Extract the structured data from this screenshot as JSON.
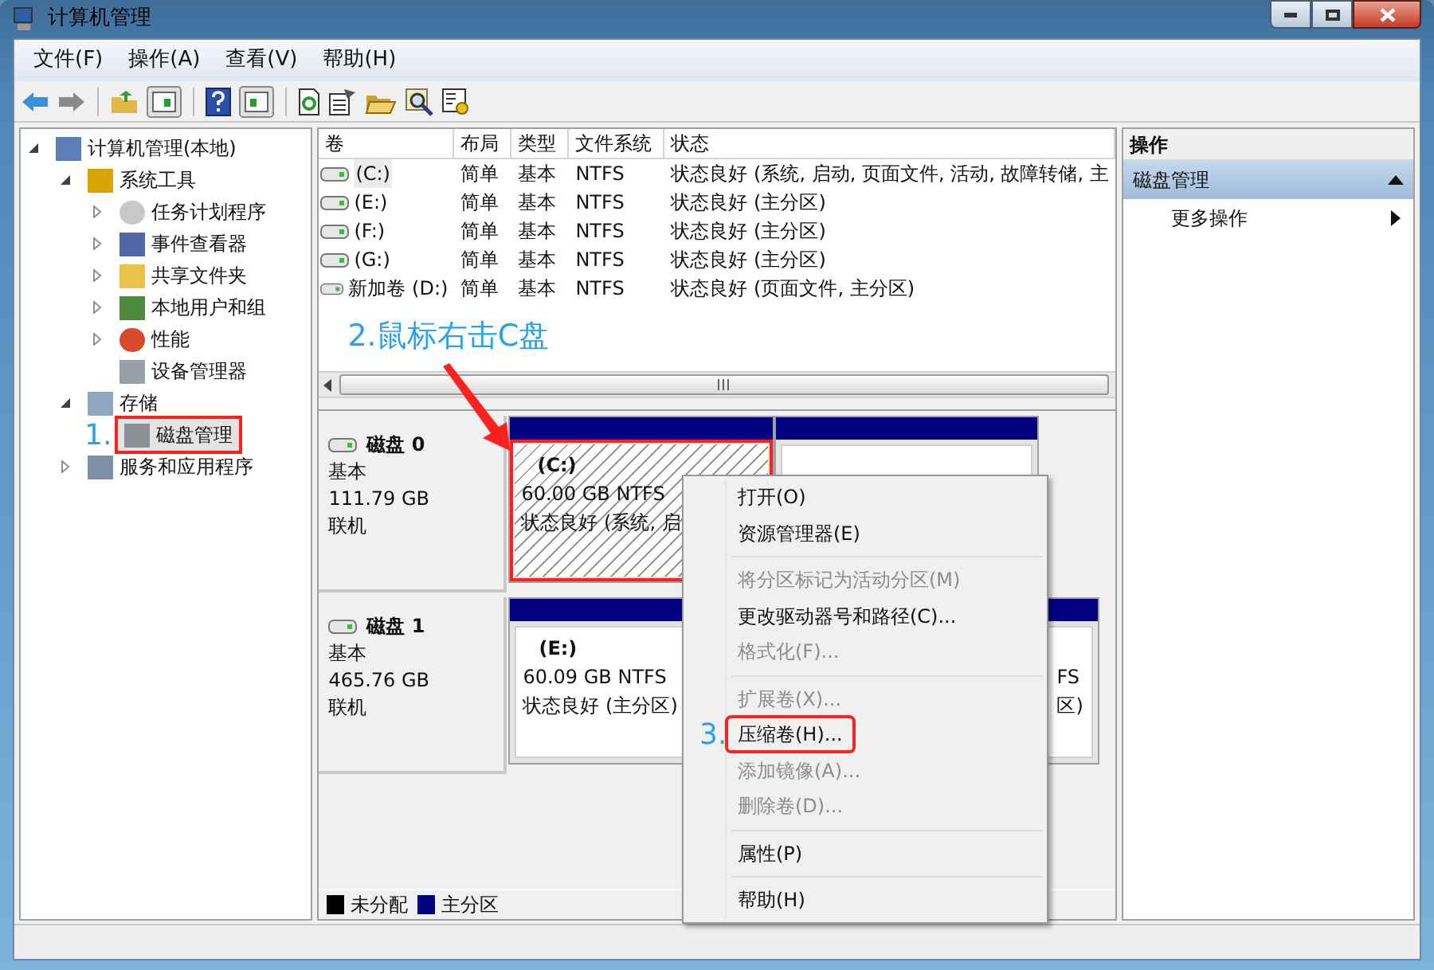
{
  "window": {
    "title": "计算机管理"
  },
  "menu_bar": [
    "文件(F)",
    "操作(A)",
    "查看(V)",
    "帮助(H)"
  ],
  "tree": [
    {
      "label": "计算机管理(本地)",
      "expanded": true,
      "selected": false,
      "children": [
        {
          "label": "系统工具",
          "expanded": true,
          "selected": false,
          "children": [
            {
              "label": "任务计划程序",
              "expanded": false,
              "selected": false
            },
            {
              "label": "事件查看器",
              "expanded": false,
              "selected": false
            },
            {
              "label": "共享文件夹",
              "expanded": false,
              "selected": false
            },
            {
              "label": "本地用户和组",
              "expanded": false,
              "selected": false
            },
            {
              "label": "性能",
              "expanded": false,
              "selected": false
            },
            {
              "label": "设备管理器",
              "selected": false
            }
          ]
        },
        {
          "label": "存储",
          "expanded": true,
          "selected": false,
          "children": [
            {
              "label": "磁盘管理",
              "selected": true,
              "highlighted": true,
              "annotation": "1."
            }
          ]
        },
        {
          "label": "服务和应用程序",
          "expanded": false,
          "selected": false
        }
      ]
    }
  ],
  "volumes": {
    "columns": [
      "卷",
      "布局",
      "类型",
      "文件系统",
      "状态"
    ],
    "rows": [
      [
        "(C:)",
        "简单",
        "基本",
        "NTFS",
        "状态良好 (系统, 启动, 页面文件, 活动, 故障转储, 主"
      ],
      [
        "(E:)",
        "简单",
        "基本",
        "NTFS",
        "状态良好 (主分区)"
      ],
      [
        "(F:)",
        "简单",
        "基本",
        "NTFS",
        "状态良好 (主分区)"
      ],
      [
        "(G:)",
        "简单",
        "基本",
        "NTFS",
        "状态良好 (主分区)"
      ],
      [
        "新加卷 (D:)",
        "简单",
        "基本",
        "NTFS",
        "状态良好 (页面文件, 主分区)"
      ]
    ]
  },
  "callout": {
    "text": "2.鼠标右击C盘"
  },
  "disks": [
    {
      "name": "磁盘 0",
      "type": "基本",
      "size": "111.79 GB",
      "status": "联机",
      "partitions": [
        {
          "kind": "system",
          "label": "(C:)",
          "size": "60.00 GB NTFS",
          "status": "状态良好 (系统, 启",
          "highlighted": true
        },
        {
          "kind": "primary"
        }
      ]
    },
    {
      "name": "磁盘 1",
      "type": "基本",
      "size": "465.76 GB",
      "status": "联机",
      "partitions": [
        {
          "kind": "primary",
          "label": "(E:)",
          "size": "60.09 GB NTFS",
          "status": "状态良好 (主分区)",
          "highlighted": false
        },
        {
          "kind": "primary",
          "size": "FS",
          "status": "区)"
        }
      ]
    }
  ],
  "legend": [
    {
      "label": "未分配",
      "color": "#000000"
    },
    {
      "label": "主分区",
      "color": "#000080"
    }
  ],
  "actions": {
    "title": "操作",
    "section": "磁盘管理",
    "items": [
      "更多操作"
    ]
  },
  "context_menu": [
    {
      "kind": "item",
      "label": "打开(O)",
      "disabled": false
    },
    {
      "kind": "item",
      "label": "资源管理器(E)",
      "disabled": false
    },
    {
      "kind": "separator"
    },
    {
      "kind": "item",
      "label": "将分区标记为活动分区(M)",
      "disabled": true
    },
    {
      "kind": "item",
      "label": "更改驱动器号和路径(C)...",
      "disabled": false
    },
    {
      "kind": "item",
      "label": "格式化(F)...",
      "disabled": true
    },
    {
      "kind": "separator"
    },
    {
      "kind": "item",
      "label": "扩展卷(X)...",
      "disabled": true
    },
    {
      "kind": "item",
      "label": "压缩卷(H)...",
      "disabled": false,
      "highlighted": true,
      "annotation": "3."
    },
    {
      "kind": "item",
      "label": "添加镜像(A)...",
      "disabled": true
    },
    {
      "kind": "item",
      "label": "删除卷(D)...",
      "disabled": true
    },
    {
      "kind": "separator"
    },
    {
      "kind": "item",
      "label": "属性(P)",
      "disabled": false
    },
    {
      "kind": "separator"
    },
    {
      "kind": "item",
      "label": "帮助(H)",
      "disabled": false
    }
  ]
}
